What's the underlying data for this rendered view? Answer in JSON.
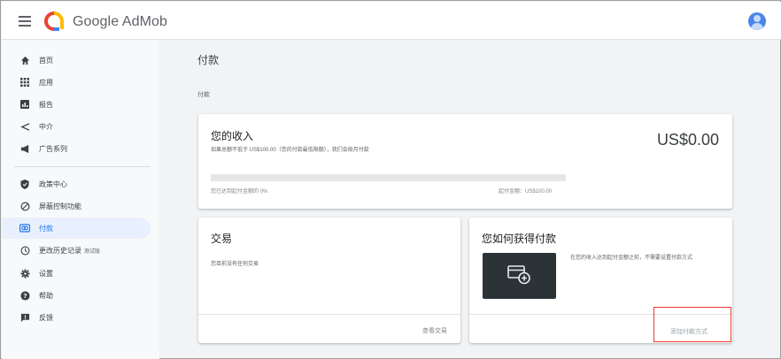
{
  "app": {
    "brand": "Google AdMob"
  },
  "sidebar": {
    "items": [
      {
        "label": "首页",
        "icon": "home-icon"
      },
      {
        "label": "应用",
        "icon": "apps-grid-icon"
      },
      {
        "label": "报告",
        "icon": "report-icon"
      },
      {
        "label": "中介",
        "icon": "mediation-icon"
      },
      {
        "label": "广告系列",
        "icon": "megaphone-icon"
      },
      {
        "label": "政策中心",
        "icon": "shield-icon"
      },
      {
        "label": "屏蔽控制功能",
        "icon": "block-icon"
      },
      {
        "label": "付款",
        "icon": "payments-icon",
        "active": true
      },
      {
        "label": "更改历史记录",
        "icon": "history-icon",
        "badge": "测试版"
      },
      {
        "label": "设置",
        "icon": "gear-icon"
      },
      {
        "label": "帮助",
        "icon": "help-icon"
      },
      {
        "label": "反馈",
        "icon": "feedback-icon"
      }
    ]
  },
  "main": {
    "title": "付款",
    "breadcrumb": "付款",
    "income": {
      "title": "您的收入",
      "subtitle": "如果总额不低于 US$100.00（您的付款最低限额），我们会按月付款",
      "amount": "US$0.00",
      "progress_fraction": 0,
      "progress_left": "您已达到起付金额的 0%",
      "progress_right": "起付金额：US$100.00"
    },
    "transactions": {
      "title": "交易",
      "body": "您目前没有任何交易",
      "link": "查看交易"
    },
    "how_paid": {
      "title": "您如何获得付款",
      "desc": "在您的收入达到起付金额之前，不需要设置付款方式",
      "link": "添加付款方式"
    }
  },
  "colors": {
    "active": "#1a73e8",
    "highlight_box": "#e53935",
    "illustration_bg": "#2c3337"
  }
}
